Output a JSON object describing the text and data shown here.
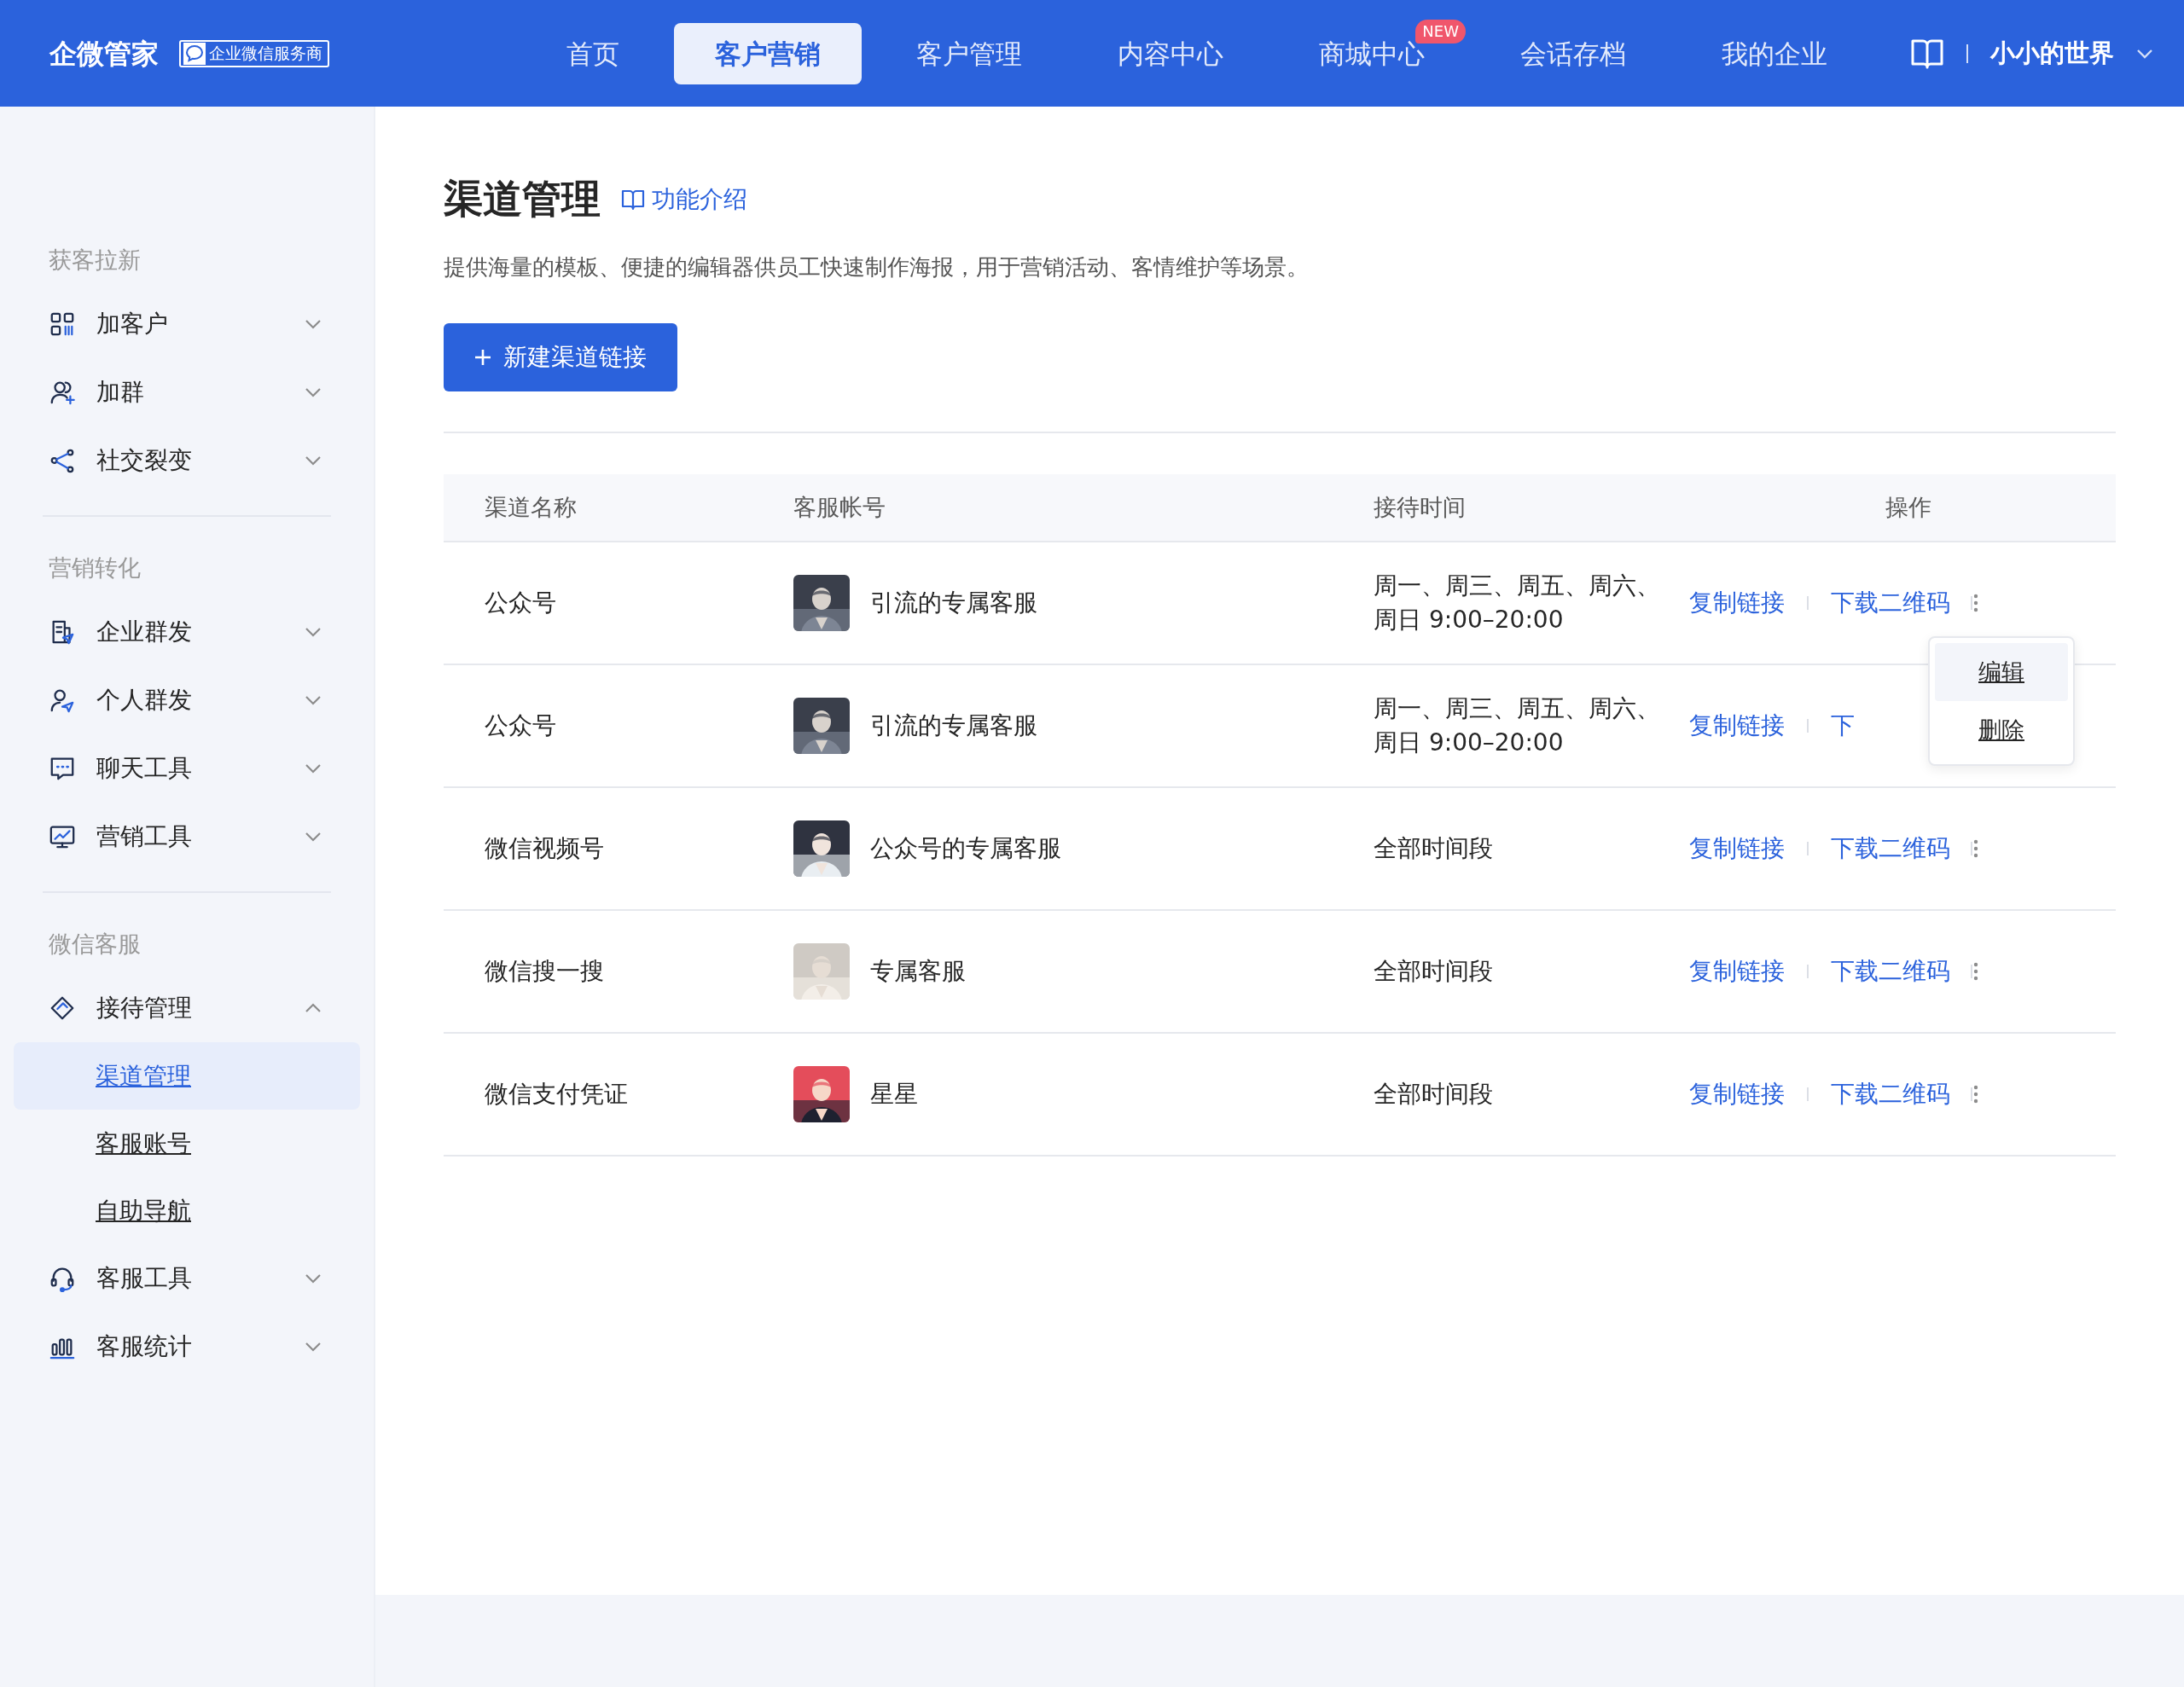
{
  "top_nav": {
    "logo": "企微管家",
    "partner_badge": "企业微信服务商",
    "user": "小小的世界",
    "tabs": [
      {
        "label": "首页",
        "selected": false
      },
      {
        "label": "客户营销",
        "selected": true
      },
      {
        "label": "客户管理",
        "selected": false
      },
      {
        "label": "内容中心",
        "selected": false
      },
      {
        "label": "商城中心",
        "selected": false,
        "badge": "NEW"
      },
      {
        "label": "会话存档",
        "selected": false
      },
      {
        "label": "我的企业",
        "selected": false
      }
    ]
  },
  "sidebar": {
    "sections": [
      {
        "title": "获客拉新",
        "items": [
          {
            "label": "加客户",
            "expanded": false
          },
          {
            "label": "加群",
            "expanded": false
          },
          {
            "label": "社交裂变",
            "expanded": false
          }
        ]
      },
      {
        "title": "营销转化",
        "items": [
          {
            "label": "企业群发",
            "expanded": false
          },
          {
            "label": "个人群发",
            "expanded": false
          },
          {
            "label": "聊天工具",
            "expanded": false
          },
          {
            "label": "营销工具",
            "expanded": false
          }
        ]
      },
      {
        "title": "微信客服",
        "items": [
          {
            "label": "接待管理",
            "expanded": true,
            "children": [
              {
                "label": "渠道管理",
                "selected": true
              },
              {
                "label": "客服账号",
                "selected": false
              },
              {
                "label": "自助导航",
                "selected": false
              }
            ]
          },
          {
            "label": "客服工具",
            "expanded": false
          },
          {
            "label": "客服统计",
            "expanded": false
          }
        ]
      }
    ]
  },
  "page": {
    "title": "渠道管理",
    "help_link": "功能介绍",
    "description": "提供海量的模板、便捷的编辑器供员工快速制作海报，用于营销活动、客情维护等场景。",
    "new_button": "新建渠道链接"
  },
  "table": {
    "columns": [
      "渠道名称",
      "客服帐号",
      "接待时间",
      "操作"
    ],
    "rows": [
      {
        "channel": "公众号",
        "account": "引流的专属客服",
        "hours": "周一、周三、周五、周六、周日 9:00–20:00",
        "copy_link": "复制链接",
        "download_qr": "下载二维码",
        "menu": [
          {
            "label": "编辑",
            "selected": true
          },
          {
            "label": "删除",
            "selected": false
          }
        ]
      },
      {
        "channel": "公众号",
        "account": "引流的专属客服",
        "hours": "周一、周三、周五、周六、周日 9:00–20:00",
        "copy_link": "复制链接",
        "download_qr": "下"
      },
      {
        "channel": "微信视频号",
        "account": "公众号的专属客服",
        "hours": "全部时间段",
        "copy_link": "复制链接",
        "download_qr": "下载二维码"
      },
      {
        "channel": "微信搜一搜",
        "account": "专属客服",
        "hours": "全部时间段",
        "copy_link": "复制链接",
        "download_qr": "下载二维码"
      },
      {
        "channel": "微信支付凭证",
        "account": "星星",
        "hours": "全部时间段",
        "copy_link": "复制链接",
        "download_qr": "下载二维码"
      }
    ]
  }
}
